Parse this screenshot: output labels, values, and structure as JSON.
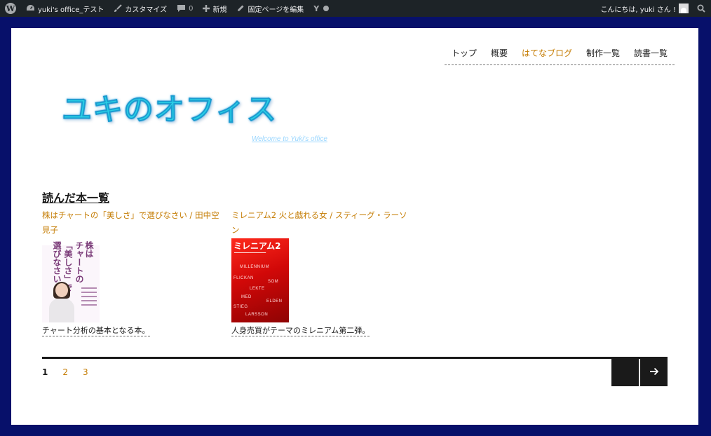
{
  "admin_bar": {
    "site_name": "yuki's office_テスト",
    "customize": "カスタマイズ",
    "comments_count": "0",
    "new": "新規",
    "edit_page": "固定ページを編集",
    "yoast": "Y",
    "greeting": "こんにちは, yuki さん !"
  },
  "nav": {
    "items": [
      {
        "label": "トップ",
        "current": false
      },
      {
        "label": "概要",
        "current": false
      },
      {
        "label": "はてなブログ",
        "current": true
      },
      {
        "label": "制作一覧",
        "current": false
      },
      {
        "label": "読書一覧",
        "current": false
      }
    ]
  },
  "header": {
    "logo_text": "ユキのオフィス",
    "tagline": "Welcome to Yuki's office"
  },
  "main": {
    "page_title": "読んだ本一覧",
    "books": [
      {
        "title": "株はチャートの「美しさ」で選びなさい / 田中空見子",
        "cover_title": "株はチャートの「美しさ」で選びなさい",
        "description": "チャート分析の基本となる本。"
      },
      {
        "title": "ミレニアム2 火と戯れる女 / スティーグ・ラーソン",
        "cover_title": "ミレニアム2",
        "cover_words": [
          "MILLENNIUM",
          "FLICKAN",
          "SOM",
          "LEKTE",
          "MED",
          "ELDEN",
          "STIEG",
          "LARSSON"
        ],
        "description": "人身売買がテーマのミレニアム第二弾。"
      }
    ]
  },
  "pagination": {
    "pages": [
      "1",
      "2",
      "3"
    ],
    "current": "1"
  },
  "colors": {
    "frame": "#07106a",
    "accent": "#c47b00",
    "admin_bar": "#1d2327"
  }
}
